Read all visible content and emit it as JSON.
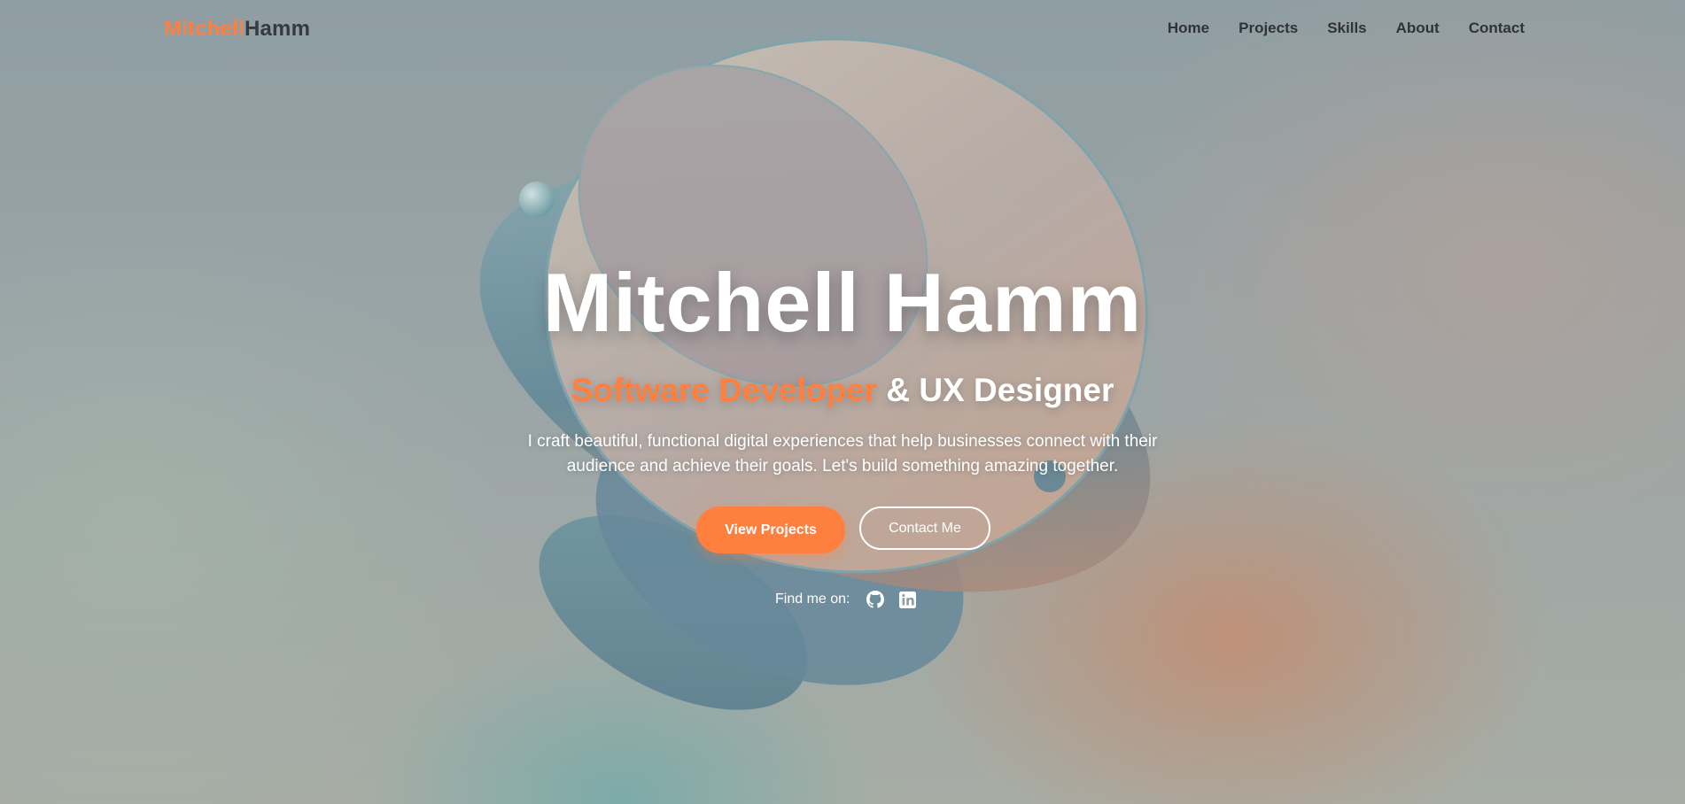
{
  "brand": {
    "first": "Mitchell",
    "last": "Hamm",
    "accent_color": "#ff7f3f"
  },
  "nav": {
    "items": [
      {
        "label": "Home"
      },
      {
        "label": "Projects"
      },
      {
        "label": "Skills"
      },
      {
        "label": "About"
      },
      {
        "label": "Contact"
      }
    ]
  },
  "hero": {
    "title": "Mitchell Hamm",
    "subtitle_accent": "Software Developer",
    "subtitle_rest": " & UX Designer",
    "description_line1": "I craft beautiful, functional digital experiences that help businesses connect with their",
    "description_line2": "audience and achieve their goals. Let's build something amazing together.",
    "primary_button": "View Projects",
    "secondary_button": "Contact Me"
  },
  "social": {
    "label": "Find me on:",
    "links": [
      {
        "icon": "github-icon"
      },
      {
        "icon": "linkedin-icon"
      }
    ]
  }
}
